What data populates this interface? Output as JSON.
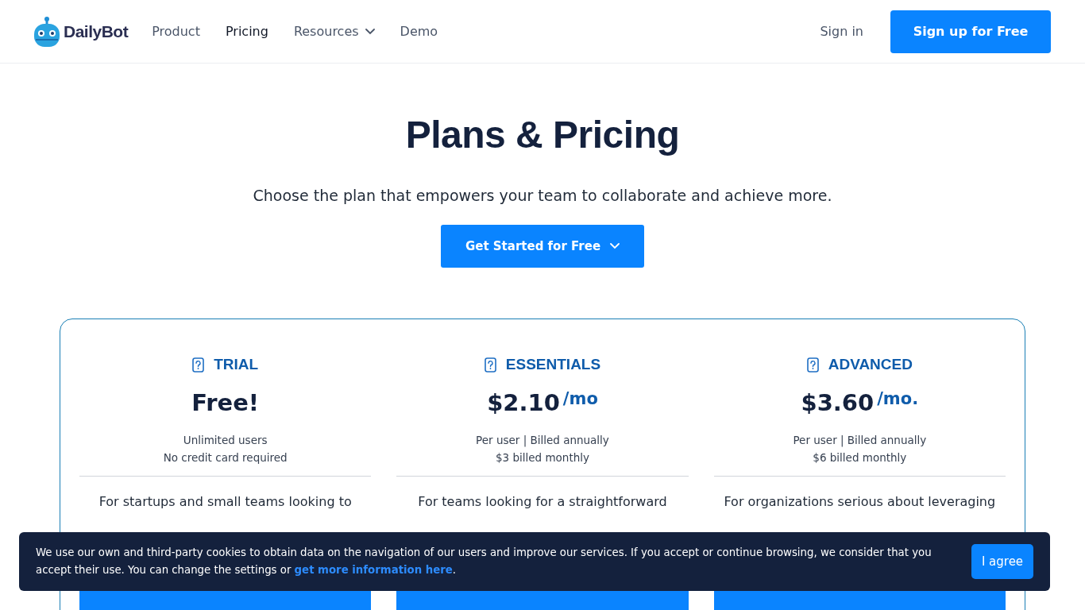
{
  "header": {
    "logo_text": "DailyBot",
    "nav": [
      {
        "label": "Product",
        "selected": false,
        "dropdown": false
      },
      {
        "label": "Pricing",
        "selected": true,
        "dropdown": false
      },
      {
        "label": "Resources",
        "selected": false,
        "dropdown": true
      },
      {
        "label": "Demo",
        "selected": false,
        "dropdown": false
      }
    ],
    "sign_in": "Sign in",
    "sign_up": "Sign up for Free"
  },
  "hero": {
    "title": "Plans & Pricing",
    "subtitle": "Choose the plan that empowers your team to collaborate and achieve more.",
    "cta": "Get Started for Free"
  },
  "plans": [
    {
      "name": "TRIAL",
      "price": "Free!",
      "notes": [
        "Unlimited users",
        "No credit card required"
      ],
      "description": "For startups and small teams looking to"
    },
    {
      "name": "ESSENTIALS",
      "price": "$2.10",
      "period": "/mo",
      "notes": [
        "Per user | Billed annually",
        "$3 billed monthly"
      ],
      "description": "For teams looking for a straightforward"
    },
    {
      "name": "ADVANCED",
      "price": "$3.60",
      "period": "/mo.",
      "notes": [
        "Per user | Billed annually",
        "$6 billed monthly"
      ],
      "description": "For organizations serious about leveraging"
    }
  ],
  "cookie_banner": {
    "text": "We use our own and third-party cookies to obtain data on the navigation of our users and improve our services. If you accept or continue browsing, we consider that you accept their use. You can change the settings or ",
    "link": "get more information here",
    "after_link": ".",
    "button": "I agree"
  }
}
